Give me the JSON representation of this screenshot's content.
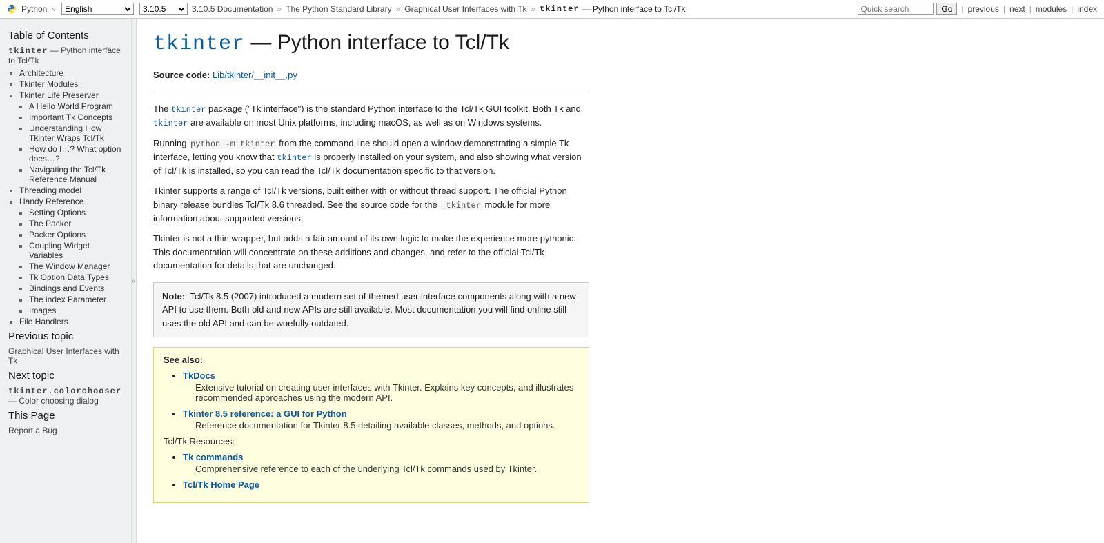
{
  "topbar": {
    "python_label": "Python",
    "lang_selected": "English",
    "version_selected": "3.10.5",
    "crumbs": {
      "doc": "3.10.5 Documentation",
      "stdlib": "The Python Standard Library",
      "gui": "Graphical User Interfaces with Tk",
      "mod": "tkinter",
      "tail": " — Python interface to Tcl/Tk"
    },
    "search_placeholder": "Quick search",
    "go": "Go",
    "nav": {
      "prev": "previous",
      "next": "next",
      "modules": "modules",
      "index": "index"
    }
  },
  "sidebar": {
    "toc_title": "Table of Contents",
    "toc_top_mod": "tkinter",
    "toc_top_tail": " — Python interface to Tcl/Tk",
    "items": [
      "Architecture",
      "Tkinter Modules",
      "Tkinter Life Preserver",
      "Threading model",
      "Handy Reference",
      "File Handlers"
    ],
    "life_preserver_sub": [
      "A Hello World Program",
      "Important Tk Concepts",
      "Understanding How Tkinter Wraps Tcl/Tk",
      "How do I…? What option does…?",
      "Navigating the Tcl/Tk Reference Manual"
    ],
    "handy_ref_sub": [
      "Setting Options",
      "The Packer",
      "Packer Options",
      "Coupling Widget Variables",
      "The Window Manager",
      "Tk Option Data Types",
      "Bindings and Events",
      "The index Parameter",
      "Images"
    ],
    "prev_title": "Previous topic",
    "prev_text": "Graphical User Interfaces with Tk",
    "next_title": "Next topic",
    "next_mod": "tkinter.colorchooser",
    "next_tail": " — Color choosing dialog",
    "this_page_title": "This Page",
    "this_page_link": "Report a Bug"
  },
  "main": {
    "h1_mod": "tkinter",
    "h1_tail": " — Python interface to Tcl/Tk",
    "source_label": "Source code:",
    "source_link": "Lib/tkinter/__init__.py",
    "p1a": "The ",
    "p1m1": "tkinter",
    "p1b": " package (\"Tk interface\") is the standard Python interface to the Tcl/Tk GUI toolkit. Both Tk and ",
    "p1m2": "tkinter",
    "p1c": " are available on most Unix platforms, including macOS, as well as on Windows systems.",
    "p2a": "Running ",
    "p2m1": "python -m tkinter",
    "p2b": " from the command line should open a window demonstrating a simple Tk interface, letting you know that ",
    "p2m2": "tkinter",
    "p2c": " is properly installed on your system, and also showing what version of Tcl/Tk is installed, so you can read the Tcl/Tk documentation specific to that version.",
    "p3a": "Tkinter supports a range of Tcl/Tk versions, built either with or without thread support. The official Python binary release bundles Tcl/Tk 8.6 threaded. See the source code for the ",
    "p3m1": "_tkinter",
    "p3b": " module for more information about supported versions.",
    "p4": "Tkinter is not a thin wrapper, but adds a fair amount of its own logic to make the experience more pythonic. This documentation will concentrate on these additions and changes, and refer to the official Tcl/Tk documentation for details that are unchanged.",
    "note_label": "Note:",
    "note_text": "Tcl/Tk 8.5 (2007) introduced a modern set of themed user interface components along with a new API to use them. Both old and new APIs are still available. Most documentation you will find online still uses the old API and can be woefully outdated.",
    "seealso_label": "See also:",
    "seealso_items1": [
      {
        "title": "TkDocs",
        "desc": "Extensive tutorial on creating user interfaces with Tkinter. Explains key concepts, and illustrates recommended approaches using the modern API."
      },
      {
        "title": "Tkinter 8.5 reference: a GUI for Python",
        "desc": "Reference documentation for Tkinter 8.5 detailing available classes, methods, and options."
      }
    ],
    "seealso_subhead": "Tcl/Tk Resources:",
    "seealso_items2": [
      {
        "title": "Tk commands",
        "desc": "Comprehensive reference to each of the underlying Tcl/Tk commands used by Tkinter."
      },
      {
        "title": "Tcl/Tk Home Page",
        "desc": ""
      }
    ]
  }
}
